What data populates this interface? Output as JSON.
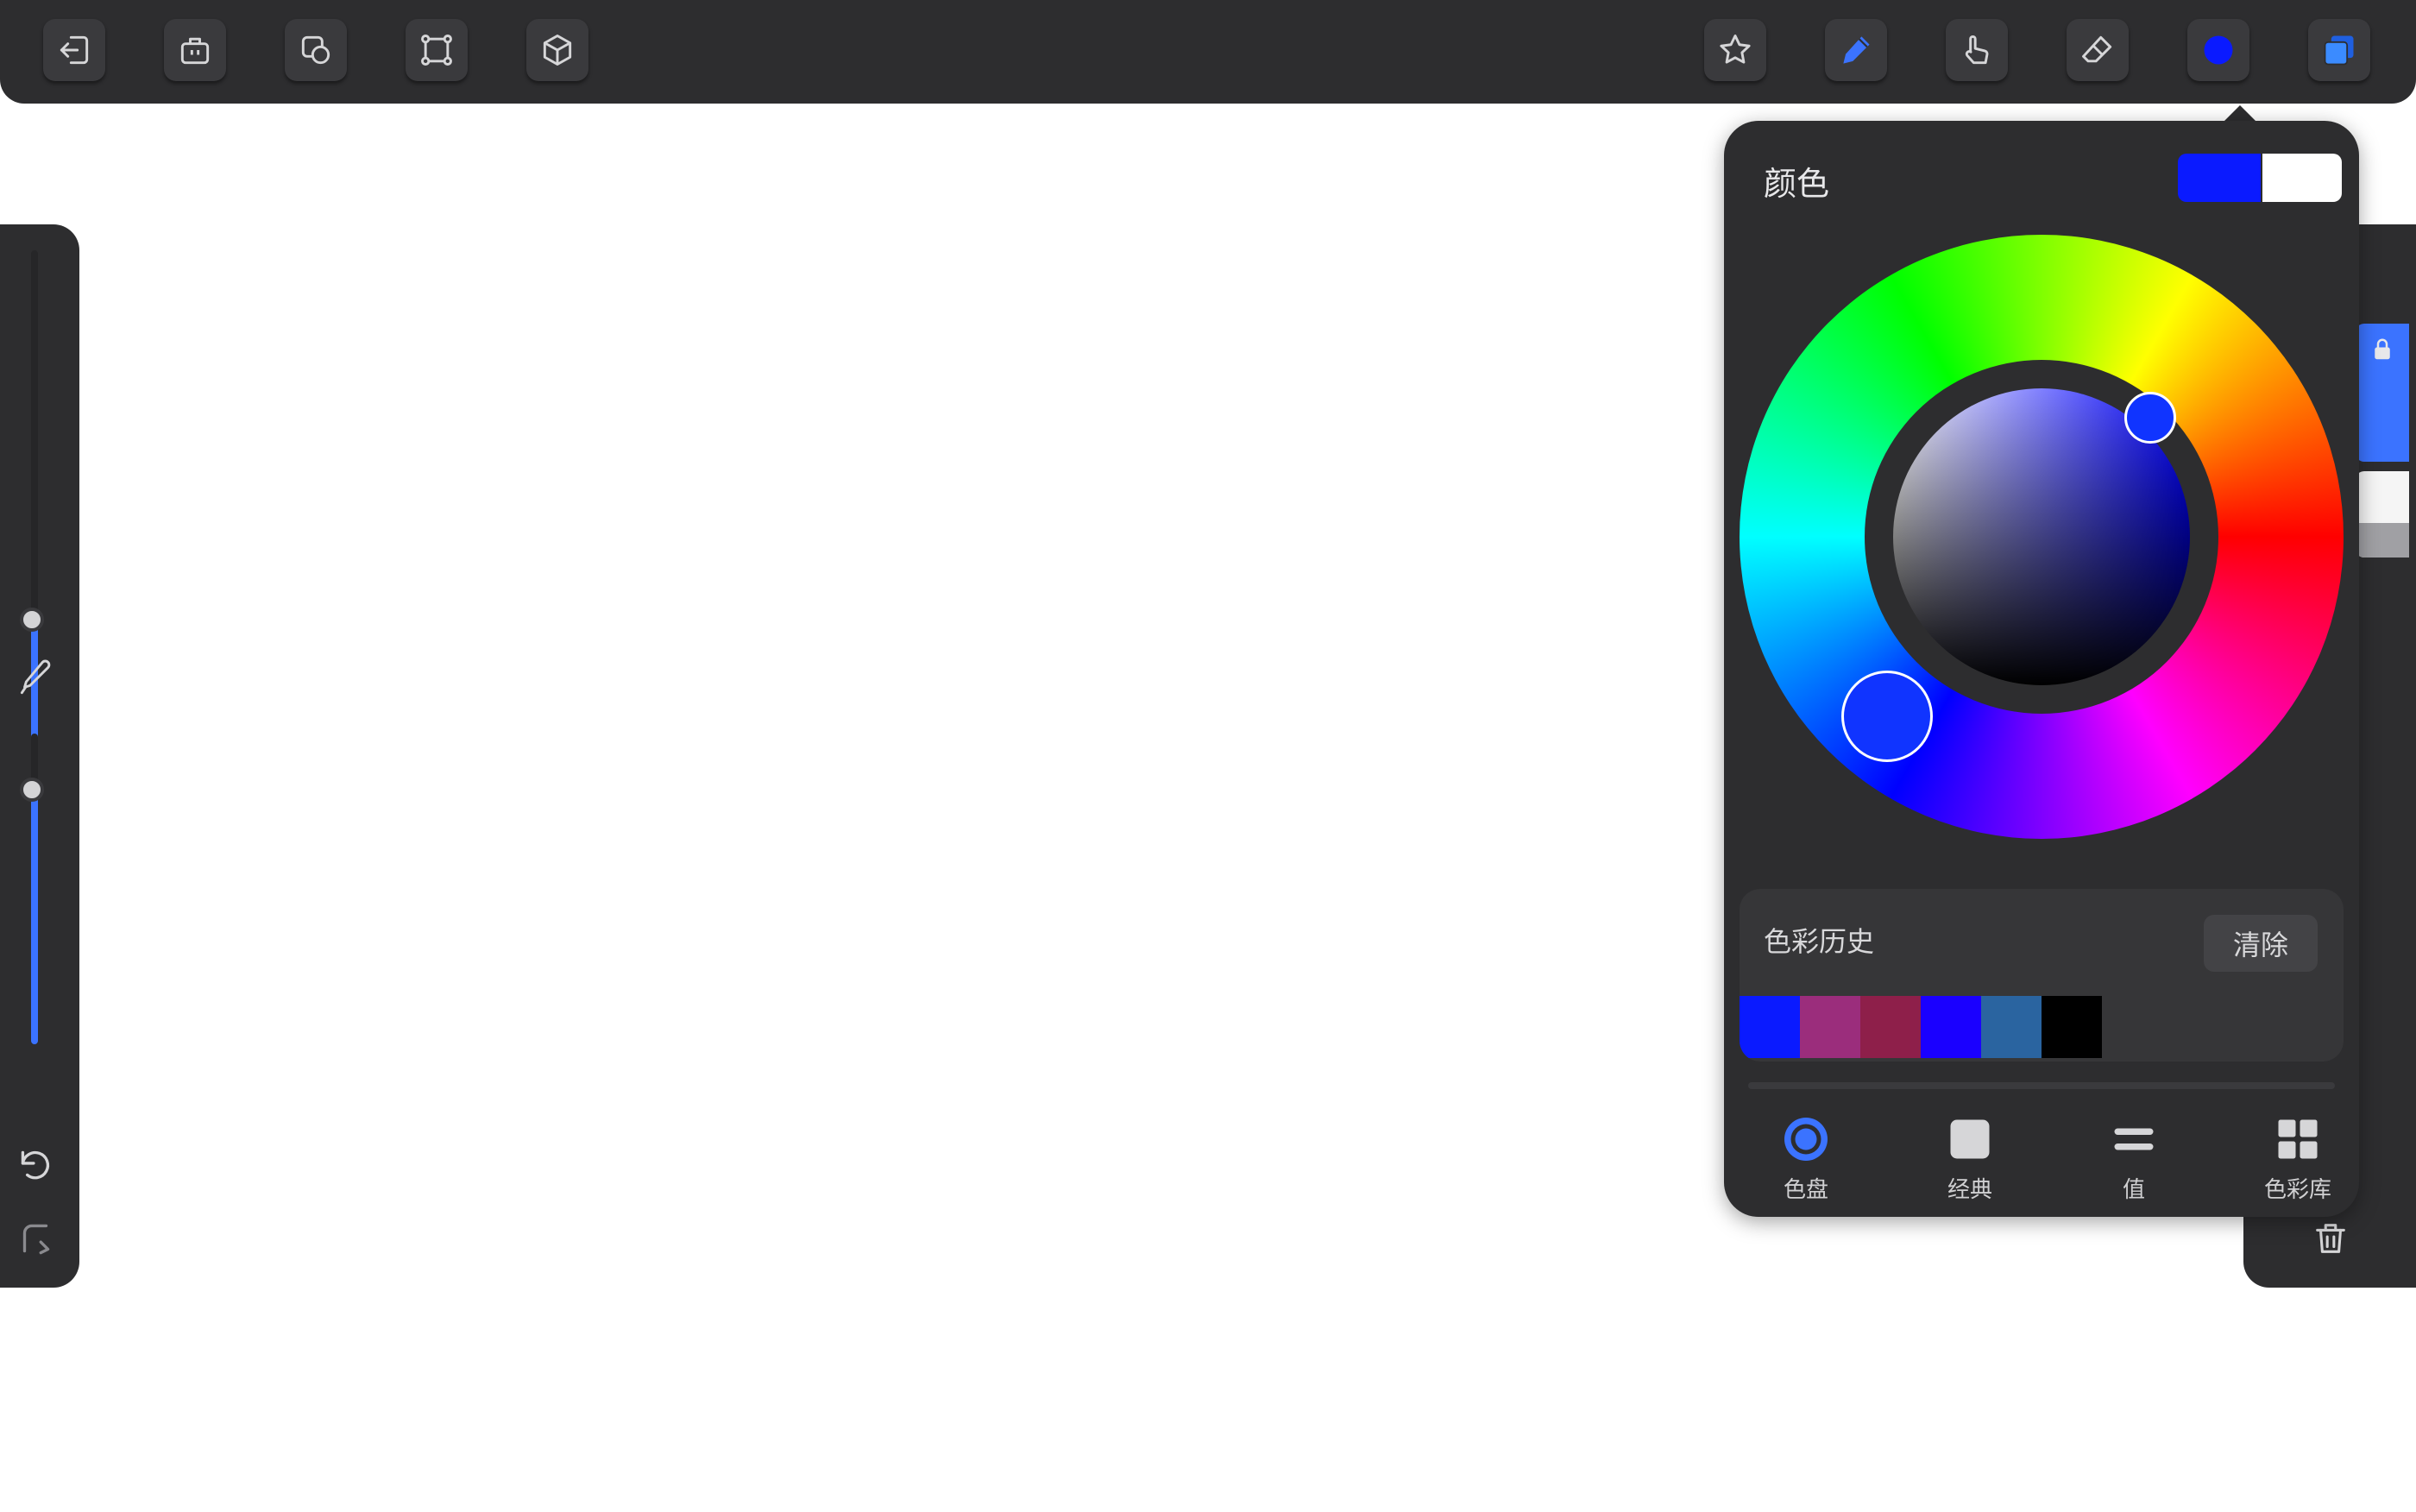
{
  "colors": {
    "bar_bg": "#2d2d2f",
    "accent": "#3b73ff",
    "primary_color": "#0a1aff",
    "secondary_color": "#ffffff"
  },
  "top_toolbar": {
    "left_buttons": [
      "exit-icon",
      "toolbox-icon",
      "shapes-icon",
      "transform-icon",
      "3d-cube-icon"
    ],
    "right_buttons": [
      "star-icon",
      "brush-icon",
      "smudge-icon",
      "eraser-icon",
      "color-icon",
      "layers-icon"
    ]
  },
  "left_sidebar": {
    "brush_size_level": 0.38,
    "opacity_level": 0.82,
    "icons": [
      "eyedropper-icon",
      "undo-icon",
      "redo-icon"
    ]
  },
  "color_panel": {
    "title": "颜色",
    "history": {
      "title": "色彩历史",
      "clear_label": "清除",
      "swatches": [
        "#0a1aff",
        "#9b2d7c",
        "#8e1f4a",
        "#1a00ff",
        "#2a64a0",
        "#000000"
      ]
    },
    "tabs": [
      {
        "label": "色盘",
        "icon": "color-disc-icon"
      },
      {
        "label": "经典",
        "icon": "classic-square-icon"
      },
      {
        "label": "值",
        "icon": "value-sliders-icon"
      },
      {
        "label": "色彩库",
        "icon": "palette-grid-icon"
      }
    ]
  },
  "right_sidebar": {
    "icons": [
      "add-layer-icon",
      "lock-icon",
      "delete-icon"
    ]
  }
}
